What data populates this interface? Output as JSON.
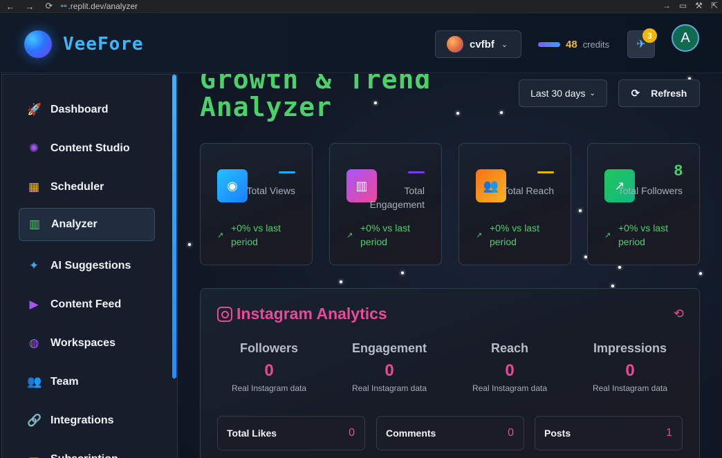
{
  "browser": {
    "url_host": ".replit.dev",
    "url_path": "/analyzer",
    "back_icon": "←",
    "forward_icon": "→",
    "reload_icon": "⟳"
  },
  "header": {
    "brand": "VeeFore",
    "workspace_name": "cvfbf",
    "credits_value": "48",
    "credits_label": "credits",
    "notification_count": "3",
    "avatar_initial": "A"
  },
  "sidebar": {
    "items": [
      {
        "label": "Dashboard",
        "icon": "rocket-icon",
        "glyph": "🚀",
        "color": "#38a8ff"
      },
      {
        "label": "Content Studio",
        "icon": "brain-icon",
        "glyph": "✺",
        "color": "#a855f7"
      },
      {
        "label": "Scheduler",
        "icon": "calendar-icon",
        "glyph": "▦",
        "color": "#f5b324"
      },
      {
        "label": "Analyzer",
        "icon": "bar-chart-icon",
        "glyph": "▥",
        "color": "#4cd06a"
      },
      {
        "label": "AI Suggestions",
        "icon": "sparkles-icon",
        "glyph": "✦",
        "color": "#38a8ff"
      },
      {
        "label": "Content Feed",
        "icon": "play-circle-icon",
        "glyph": "▶",
        "color": "#a855f7"
      },
      {
        "label": "Workspaces",
        "icon": "globe-icon",
        "glyph": "◍",
        "color": "#a855f7"
      },
      {
        "label": "Team",
        "icon": "users-icon",
        "glyph": "👥",
        "color": "#38a8ff"
      },
      {
        "label": "Integrations",
        "icon": "link-icon",
        "glyph": "🔗",
        "color": "#ec4899"
      },
      {
        "label": "Subscription",
        "icon": "card-icon",
        "glyph": "▭",
        "color": "#f5b324"
      }
    ],
    "active_index": 3
  },
  "main": {
    "title": "Growth & Trend Analyzer",
    "range_label": "Last 30 days",
    "refresh_label": "Refresh"
  },
  "stats": [
    {
      "label": "Total Views",
      "value": "",
      "trend": "+0% vs last period",
      "icon": "eye-icon",
      "color": "#1ea7ff",
      "dash_color": "#1ea7ff"
    },
    {
      "label": "Total Engagement",
      "value": "",
      "trend": "+0% vs last period",
      "icon": "bar-chart-icon",
      "color": "#8b5cf6",
      "dash_color": "#7c3aed"
    },
    {
      "label": "Total Reach",
      "value": "",
      "trend": "+0% vs last period",
      "icon": "users-icon",
      "color": "#f59e0b",
      "dash_color": "#eab308"
    },
    {
      "label": "Total Followers",
      "value": "8",
      "trend": "+0% vs last period",
      "icon": "trending-up-icon",
      "color": "#22c55e",
      "dash_color": ""
    }
  ],
  "instagram": {
    "title": "Instagram Analytics",
    "metrics": [
      {
        "label": "Followers",
        "value": "0",
        "sub": "Real Instagram data"
      },
      {
        "label": "Engagement",
        "value": "0",
        "sub": "Real Instagram data"
      },
      {
        "label": "Reach",
        "value": "0",
        "sub": "Real Instagram data"
      },
      {
        "label": "Impressions",
        "value": "0",
        "sub": "Real Instagram data"
      }
    ],
    "totals": [
      {
        "label": "Total Likes",
        "value": "0"
      },
      {
        "label": "Comments",
        "value": "0"
      },
      {
        "label": "Posts",
        "value": "1"
      }
    ]
  }
}
